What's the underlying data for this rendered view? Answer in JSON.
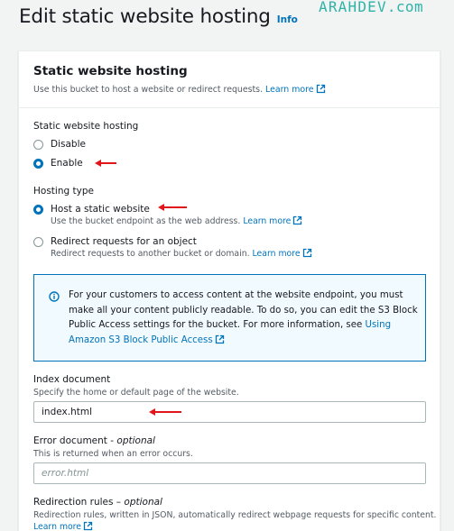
{
  "page": {
    "title": "Edit static website hosting",
    "info_label": "Info"
  },
  "watermark": {
    "text": "ARAHDEV",
    "suffix": ".com"
  },
  "panel": {
    "title": "Static website hosting",
    "description": "Use this bucket to host a website or redirect requests.",
    "learn_more": "Learn more"
  },
  "hosting": {
    "label": "Static website hosting",
    "options": [
      {
        "label": "Disable",
        "selected": false
      },
      {
        "label": "Enable",
        "selected": true
      }
    ]
  },
  "hosting_type": {
    "label": "Hosting type",
    "options": [
      {
        "label": "Host a static website",
        "description": "Use the bucket endpoint as the web address.",
        "learn_more": "Learn more",
        "selected": true
      },
      {
        "label": "Redirect requests for an object",
        "description": "Redirect requests to another bucket or domain.",
        "learn_more": "Learn more",
        "selected": false
      }
    ]
  },
  "alert": {
    "text": "For your customers to access content at the website endpoint, you must make all your content publicly readable. To do so, you can edit the S3 Block Public Access settings for the bucket. For more information, see",
    "link": "Using Amazon S3 Block Public Access"
  },
  "index_document": {
    "label": "Index document",
    "hint": "Specify the home or default page of the website.",
    "value": "index.html"
  },
  "error_document": {
    "label": "Error document",
    "optional": "optional",
    "hint": "This is returned when an error occurs.",
    "placeholder": "error.html",
    "value": ""
  },
  "redirection_rules": {
    "label": "Redirection rules",
    "optional": "optional",
    "hint": "Redirection rules, written in JSON, automatically redirect webpage requests for specific content.",
    "learn_more": "Learn more"
  },
  "colors": {
    "accent": "#0073bb",
    "annotation_arrow": "#e0161a",
    "watermark": "#2fb3a7",
    "alert_bg": "#f1faff"
  }
}
